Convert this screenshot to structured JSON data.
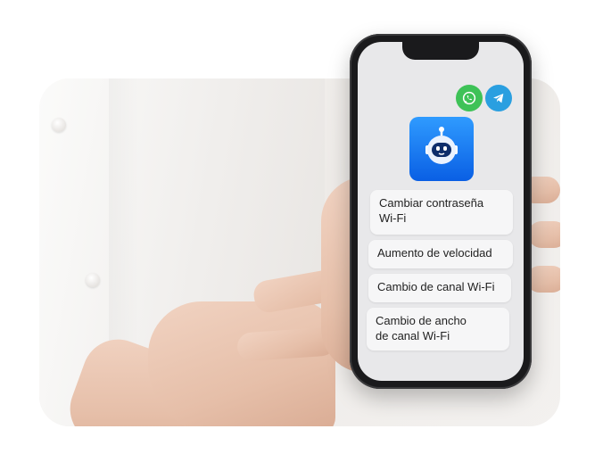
{
  "apps": [
    {
      "name": "whatsapp-icon",
      "color": "#3ec257"
    },
    {
      "name": "telegram-icon",
      "color": "#2a9fe0"
    }
  ],
  "bot": {
    "icon": "robot-icon",
    "color": "#1a7cf2"
  },
  "options": [
    {
      "label": "Cambiar contraseña\nWi-Fi"
    },
    {
      "label": "Aumento de velocidad"
    },
    {
      "label": "Cambio de canal Wi-Fi"
    },
    {
      "label": "Cambio de ancho\nde canal Wi-Fi"
    }
  ]
}
